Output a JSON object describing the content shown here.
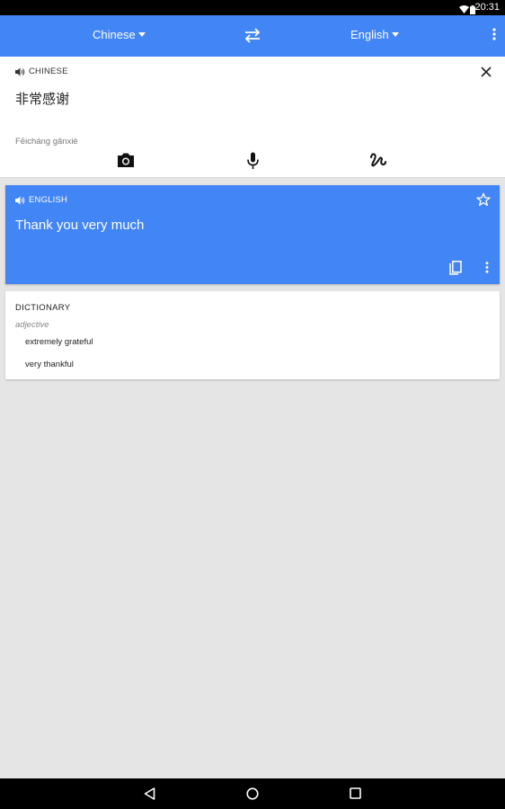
{
  "status_bar": {
    "time": "20:31"
  },
  "header": {
    "source_language": "Chinese",
    "target_language": "English"
  },
  "input": {
    "language_label": "CHINESE",
    "text": "非常感谢",
    "romanization": "Fēicháng gǎnxiè"
  },
  "result": {
    "language_label": "ENGLISH",
    "text": "Thank you very much"
  },
  "dictionary": {
    "title": "DICTIONARY",
    "part_of_speech": "adjective",
    "entries": [
      "extremely grateful",
      "very thankful"
    ]
  },
  "colors": {
    "accent": "#4285f4",
    "background": "#e5e5e5"
  },
  "icons": {
    "input_speaker": "volume-icon",
    "close": "close-icon",
    "camera": "camera-icon",
    "microphone": "microphone-icon",
    "handwriting": "handwriting-icon",
    "result_speaker": "volume-icon",
    "star": "star-icon",
    "copy": "copy-icon",
    "more": "more-vert-icon",
    "swap": "swap-icon",
    "back": "back-icon",
    "home": "home-icon",
    "recents": "recents-icon"
  }
}
